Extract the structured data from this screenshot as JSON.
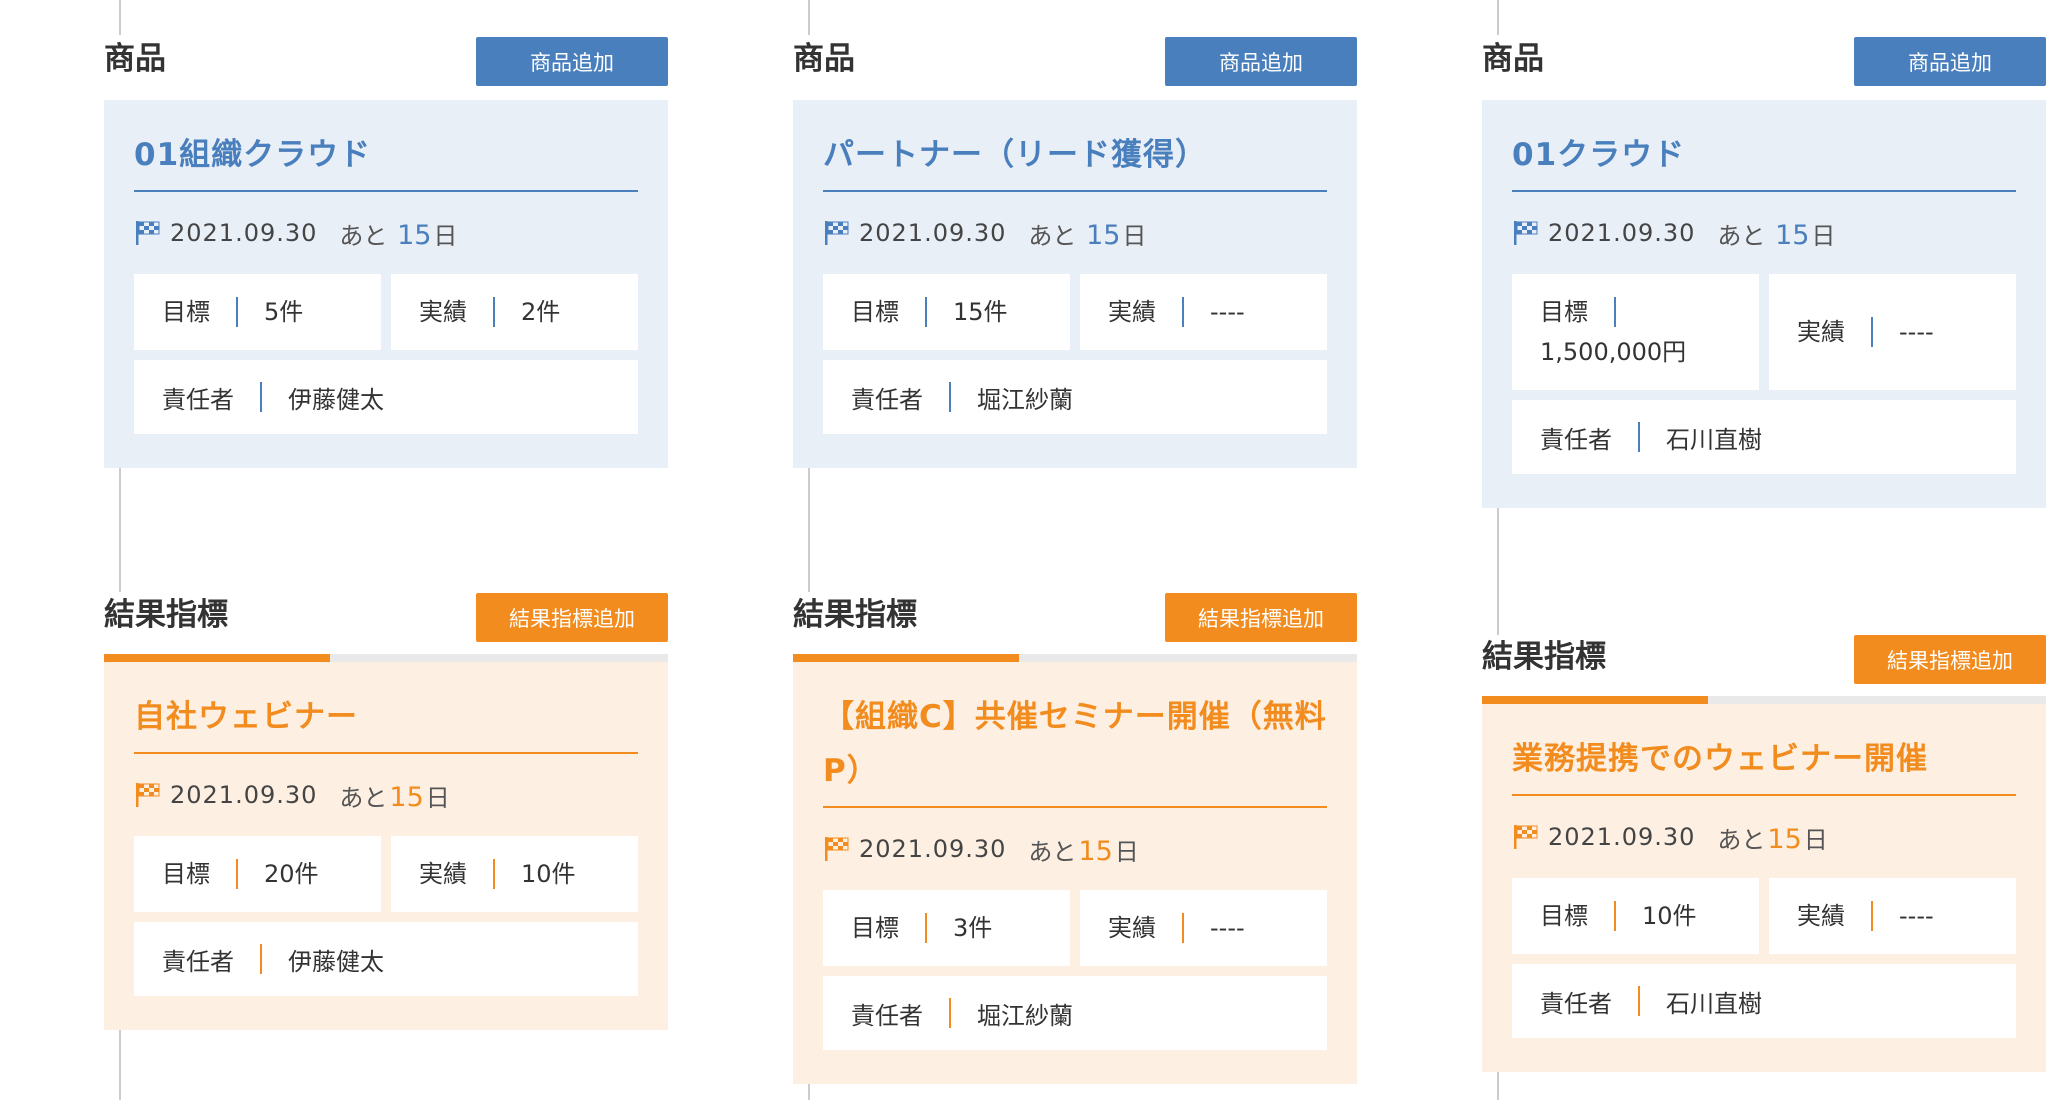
{
  "columns": [
    {
      "product": {
        "section_title": "商品",
        "add_label": "商品追加",
        "title": "01組織クラウド",
        "date": "2021.09.30",
        "remain_prefix": "あと",
        "remain_days": "15",
        "remain_suffix": "日",
        "target_label": "目標",
        "target": "5件",
        "actual_label": "実績",
        "actual": "2件",
        "owner_label": "責任者",
        "owner": "伊藤健太"
      },
      "kpi": {
        "section_title": "結果指標",
        "add_label": "結果指標追加",
        "title": "自社ウェビナー",
        "date": "2021.09.30",
        "remain_prefix": "あと",
        "remain_days": "15",
        "remain_suffix": "日",
        "target_label": "目標",
        "target": "20件",
        "actual_label": "実績",
        "actual": "10件",
        "owner_label": "責任者",
        "owner": "伊藤健太"
      }
    },
    {
      "product": {
        "section_title": "商品",
        "add_label": "商品追加",
        "title": "パートナー（リード獲得）",
        "date": "2021.09.30",
        "remain_prefix": "あと",
        "remain_days": "15",
        "remain_suffix": "日",
        "target_label": "目標",
        "target": "15件",
        "actual_label": "実績",
        "actual": "----",
        "owner_label": "責任者",
        "owner": "堀江紗蘭"
      },
      "kpi": {
        "section_title": "結果指標",
        "add_label": "結果指標追加",
        "title": "【組織C】共催セミナー開催（無料P）",
        "date": "2021.09.30",
        "remain_prefix": "あと",
        "remain_days": "15",
        "remain_suffix": "日",
        "target_label": "目標",
        "target": "3件",
        "actual_label": "実績",
        "actual": "----",
        "owner_label": "責任者",
        "owner": "堀江紗蘭"
      }
    },
    {
      "product": {
        "section_title": "商品",
        "add_label": "商品追加",
        "title": "01クラウド",
        "date": "2021.09.30",
        "remain_prefix": "あと",
        "remain_days": "15",
        "remain_suffix": "日",
        "target_label": "目標",
        "target": "1,500,000円",
        "actual_label": "実績",
        "actual": "----",
        "owner_label": "責任者",
        "owner": "石川直樹"
      },
      "kpi": {
        "section_title": "結果指標",
        "add_label": "結果指標追加",
        "title": "業務提携でのウェビナー開催",
        "date": "2021.09.30",
        "remain_prefix": "あと",
        "remain_days": "15",
        "remain_suffix": "日",
        "target_label": "目標",
        "target": "10件",
        "actual_label": "実績",
        "actual": "----",
        "owner_label": "責任者",
        "owner": "石川直樹"
      }
    }
  ],
  "colors": {
    "product_accent": "#4a7fbd",
    "product_bg": "#e9eff7",
    "kpi_accent": "#f28c1e",
    "kpi_bg": "#fdf0e3"
  },
  "icons": [
    "flag-icon"
  ]
}
